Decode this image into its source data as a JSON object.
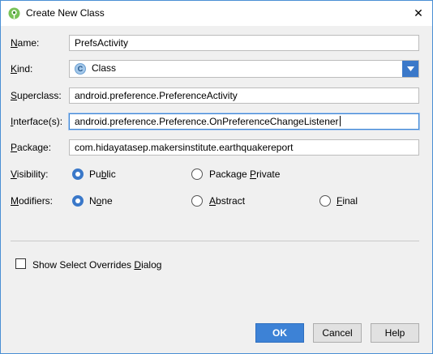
{
  "window": {
    "title": "Create New Class",
    "icon": "android-studio-icon",
    "close_glyph": "✕"
  },
  "form": {
    "name": {
      "label_mn": "N",
      "label_rest": "ame:",
      "value": "PrefsActivity"
    },
    "kind": {
      "label_mn": "K",
      "label_rest": "ind:",
      "value": "Class",
      "icon_letter": "C",
      "icon": "class-icon"
    },
    "superclass": {
      "label_mn": "S",
      "label_rest": "uperclass:",
      "value": "android.preference.PreferenceActivity"
    },
    "interfaces": {
      "label_mn": "I",
      "label_rest": "nterface(s):",
      "value": "android.preference.Preference.OnPreferenceChangeListener"
    },
    "package": {
      "label_mn": "P",
      "label_rest": "ackage:",
      "value": "com.hidayatasep.makersinstitute.earthquakereport"
    },
    "visibility": {
      "label_mn": "V",
      "label_rest": "isibility:",
      "options": [
        {
          "pre": "Pu",
          "mn": "b",
          "post": "lic",
          "checked": true
        },
        {
          "pre": "Package ",
          "mn": "P",
          "post": "rivate",
          "checked": false
        }
      ]
    },
    "modifiers": {
      "label_mn": "M",
      "label_rest": "odifiers:",
      "options": [
        {
          "pre": "N",
          "mn": "o",
          "post": "ne",
          "checked": true
        },
        {
          "pre": "",
          "mn": "A",
          "post": "bstract",
          "checked": false
        },
        {
          "pre": "",
          "mn": "F",
          "post": "inal",
          "checked": false
        }
      ]
    },
    "overrides_checkbox": {
      "pre": "Show Select Overrides ",
      "mn": "D",
      "post": "ialog",
      "checked": false
    }
  },
  "buttons": {
    "ok": "OK",
    "cancel": "Cancel",
    "help": "Help"
  },
  "colors": {
    "accent": "#3d82d6",
    "window_border": "#4a8fd4",
    "background": "#f0f0f0",
    "android_green": "#78c257"
  }
}
